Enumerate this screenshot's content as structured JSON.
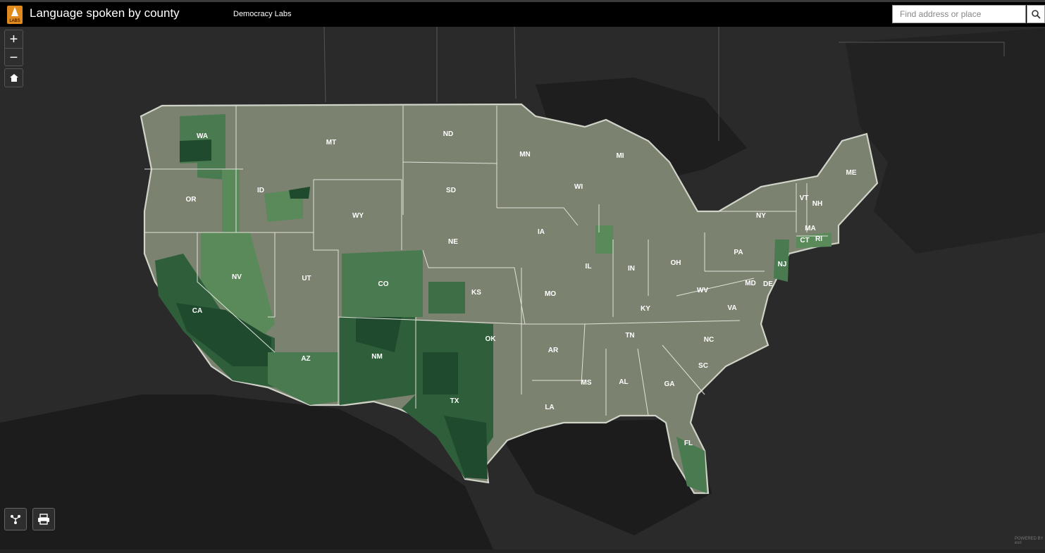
{
  "header": {
    "title": "Language spoken by county",
    "subtitle": "Democracy Labs",
    "logo_text": "LABS",
    "search": {
      "placeholder": "Find address or place"
    }
  },
  "controls": {
    "zoom_in": "+",
    "zoom_out": "−"
  },
  "map": {
    "basemap": "dark-gray",
    "colors": {
      "base": "#7b826f",
      "light_green": "#6f8a6a",
      "mid_green": "#4a7a50",
      "dark_green": "#1f4a2e",
      "land": "#2c2c2c",
      "water": "#1a1a1a"
    },
    "states": [
      "WA",
      "MT",
      "ND",
      "MN",
      "MI",
      "ME",
      "OR",
      "ID",
      "SD",
      "WI",
      "VT",
      "NH",
      "NY",
      "MA",
      "CT",
      "RI",
      "WY",
      "IA",
      "NE",
      "PA",
      "NJ",
      "NV",
      "UT",
      "CO",
      "IL",
      "IN",
      "OH",
      "CA",
      "KS",
      "MO",
      "WV",
      "MD",
      "DE",
      "KY",
      "VA",
      "TN",
      "NC",
      "OK",
      "AR",
      "AZ",
      "NM",
      "SC",
      "MS",
      "AL",
      "GA",
      "LA",
      "TX",
      "FL"
    ]
  },
  "attribution": "POWERED BY esri"
}
